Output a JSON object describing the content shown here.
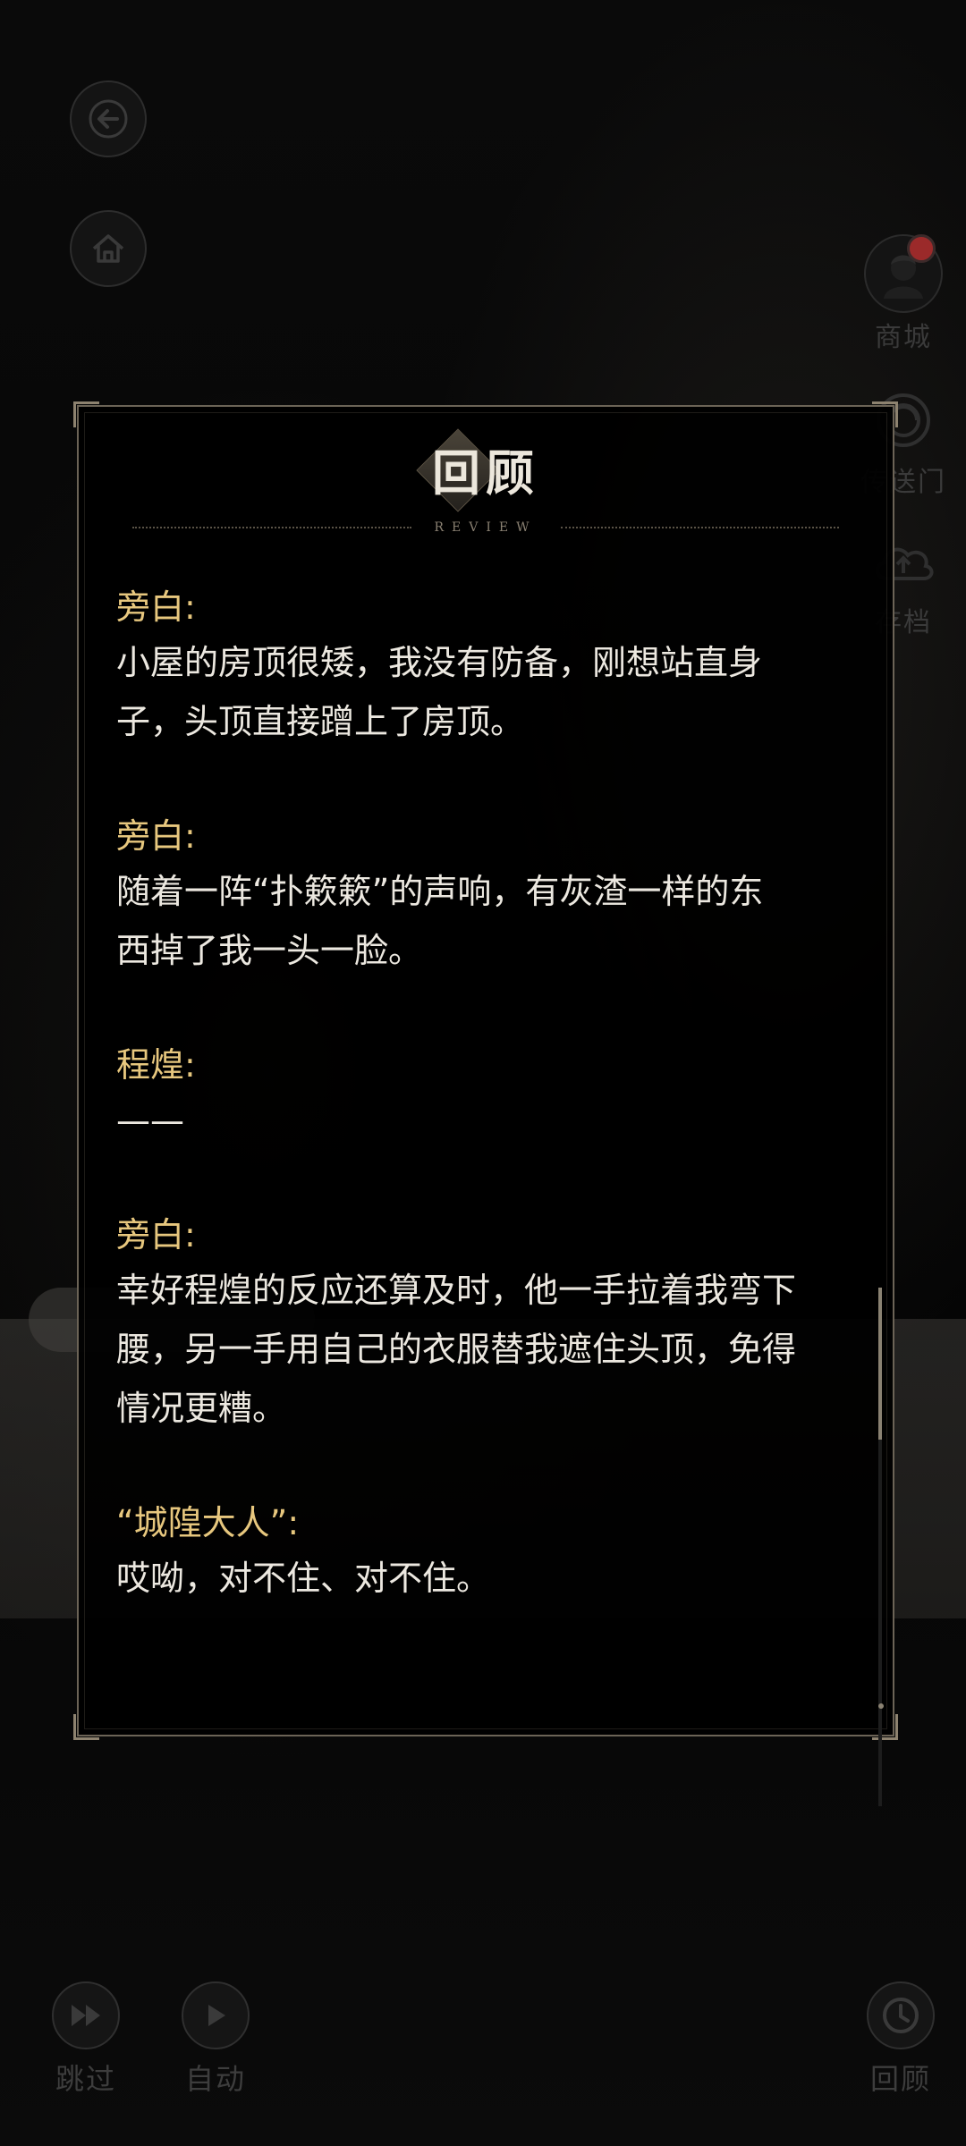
{
  "side_menu": {
    "shop_label": "商城",
    "portal_label": "传送门",
    "save_label": "存档"
  },
  "bottom_bar": {
    "skip_label": "跳过",
    "auto_label": "自动",
    "review_label": "回顾"
  },
  "review_panel": {
    "title": "回顾",
    "subtitle": "REVIEW",
    "entries": [
      {
        "speaker": "旁白:",
        "lines": [
          "小屋的房顶很矮，我没有防备，刚想站直身",
          "子，头顶直接蹭上了房顶。"
        ]
      },
      {
        "speaker": "旁白:",
        "lines": [
          "随着一阵“扑簌簌”的声响，有灰渣一样的东",
          "西掉了我一头一脸。"
        ]
      },
      {
        "speaker": "程煌:",
        "lines": [
          "——"
        ]
      },
      {
        "speaker": "旁白:",
        "lines": [
          "幸好程煌的反应还算及时，他一手拉着我弯下",
          "腰，另一手用自己的衣服替我遮住头顶，免得",
          "情况更糟。"
        ]
      },
      {
        "speaker": "“城隍大人”:",
        "lines": [
          "哎呦，对不住、对不住。"
        ]
      }
    ]
  }
}
